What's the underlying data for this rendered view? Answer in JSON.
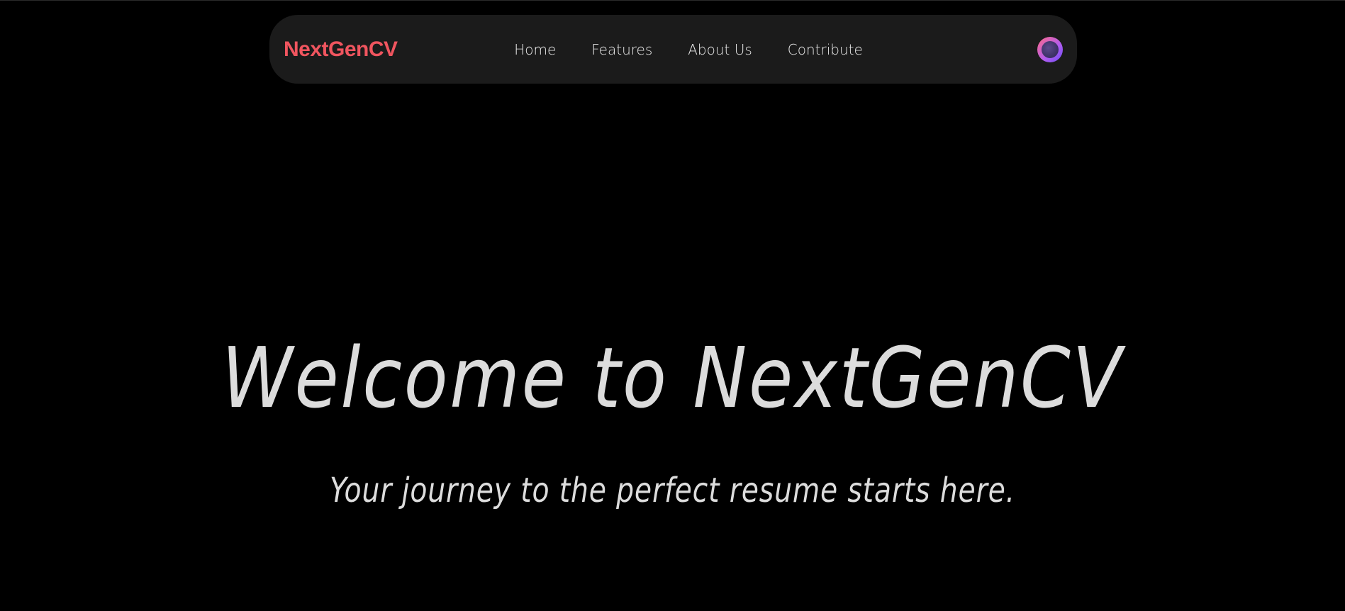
{
  "header": {
    "logo_text": "NextGenCV",
    "nav": [
      {
        "label": "Home"
      },
      {
        "label": "Features"
      },
      {
        "label": "About Us"
      },
      {
        "label": "Contribute"
      }
    ],
    "avatar_icon": "user-avatar-icon"
  },
  "hero": {
    "title": "Welcome to NextGenCV",
    "subtitle": "Your journey to the perfect resume starts here."
  },
  "colors": {
    "background": "#000000",
    "navbar": "#1b1b1b",
    "brand": "#f0555f",
    "text": "#dcdcdc"
  }
}
